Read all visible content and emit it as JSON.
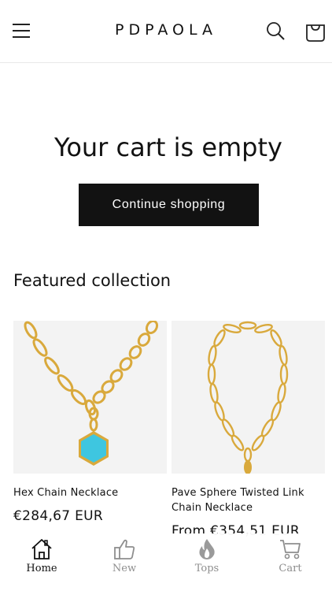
{
  "header": {
    "logo": "PDPAOLA",
    "menu_icon": "hamburger-menu-icon",
    "search_icon": "search-icon",
    "cart_icon": "shopping-bag-icon"
  },
  "cart": {
    "empty_message": "Your cart is empty",
    "continue_label": "Continue shopping"
  },
  "featured": {
    "title": "Featured collection",
    "products": [
      {
        "name": "Hex Chain Necklace",
        "price": "€284,67 EUR"
      },
      {
        "name": "Pave Sphere Twisted Link Chain Necklace",
        "price": "From €354,51 EUR"
      }
    ]
  },
  "tabbar": {
    "tabs": [
      {
        "label": "Home",
        "icon": "home-icon",
        "active": true
      },
      {
        "label": "New",
        "icon": "thumbs-up-icon",
        "active": false
      },
      {
        "label": "Tops",
        "icon": "flame-icon",
        "active": false
      },
      {
        "label": "Cart",
        "icon": "cart-icon",
        "active": false
      }
    ]
  },
  "colors": {
    "primary": "#121212",
    "accent_turquoise": "#3ec6e0",
    "gold": "#d9a93c",
    "tab_inactive": "#8e8e8e"
  }
}
